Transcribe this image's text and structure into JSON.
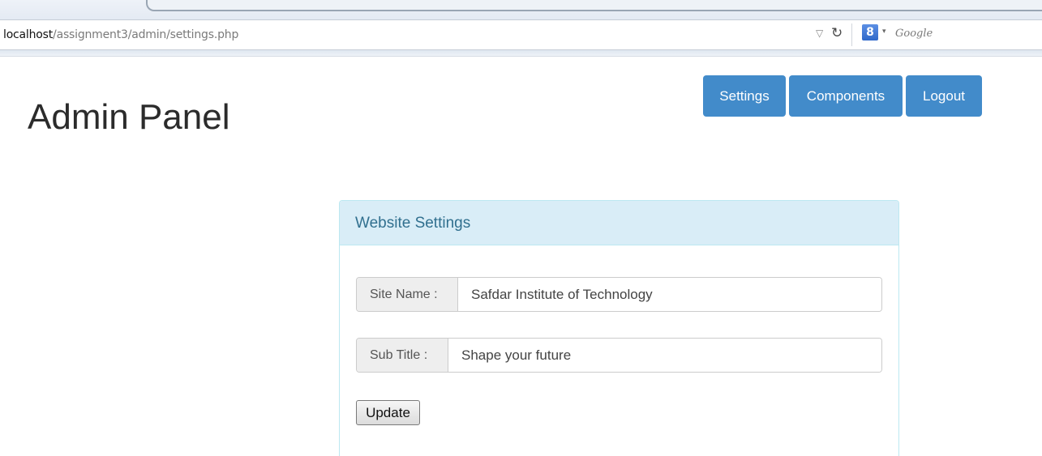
{
  "browser": {
    "url_host": "localhost",
    "url_path": "/assignment3/admin/settings.php",
    "search_placeholder": "Google",
    "search_engine_glyph": "8",
    "icons": {
      "dropdown": "dropdown-arrow-icon",
      "reload": "reload-icon",
      "search_engine": "google-search-engine-icon"
    }
  },
  "page": {
    "title": "Admin Panel"
  },
  "nav": {
    "settings": "Settings",
    "components": "Components",
    "logout": "Logout"
  },
  "panel": {
    "heading": "Website Settings",
    "site_name": {
      "label": "Site Name :",
      "value": "Safdar Institute of Technology"
    },
    "sub_title": {
      "label": "Sub Title :",
      "value": "Shape your future"
    },
    "update_label": "Update"
  },
  "colors": {
    "primary": "#428bca",
    "panel_heading_bg": "#d9edf7",
    "panel_heading_text": "#31708f",
    "panel_border": "#bce8f1"
  }
}
